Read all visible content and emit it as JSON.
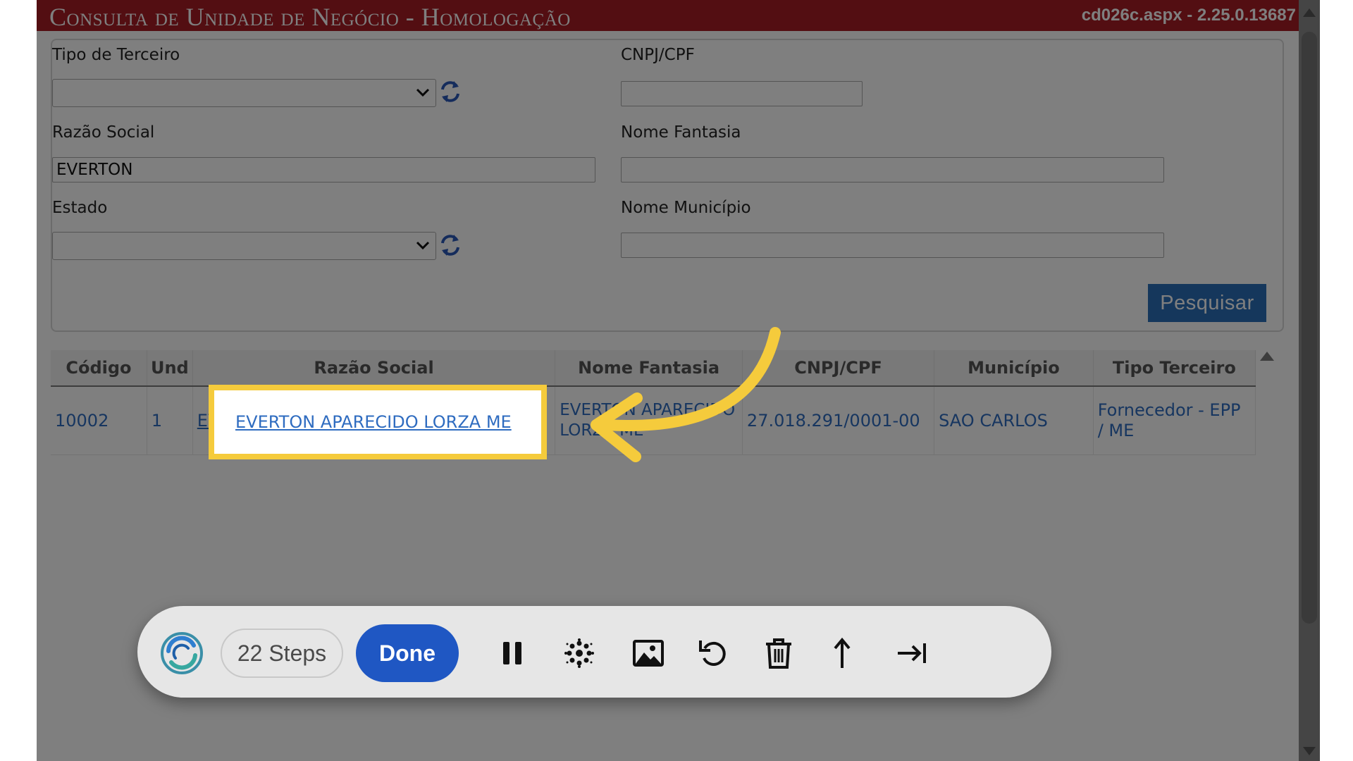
{
  "header": {
    "title": "Consulta de Unidade de Negócio  - Homologação",
    "page_info": "cd026c.aspx - 2.25.0.13687"
  },
  "form": {
    "tipo_terceiro": {
      "label": "Tipo de Terceiro",
      "value": ""
    },
    "cnpj_cpf": {
      "label": "CNPJ/CPF",
      "value": ""
    },
    "razao_social": {
      "label": "Razão Social",
      "value": "EVERTON"
    },
    "nome_fantasia": {
      "label": "Nome Fantasia",
      "value": ""
    },
    "estado": {
      "label": "Estado",
      "value": ""
    },
    "nome_municipio": {
      "label": "Nome Município",
      "value": ""
    },
    "search_button": "Pesquisar"
  },
  "results": {
    "columns": [
      "Código",
      "Und",
      "Razão Social",
      "Nome Fantasia",
      "CNPJ/CPF",
      "Município",
      "Tipo Terceiro"
    ],
    "rows": [
      {
        "codigo": "10002",
        "und": "1",
        "razao_social": "EVERTON APARECIDO LORZA ME",
        "nome_fantasia": "EVERTON APARECIDO LORZA ME",
        "cnpj_cpf": "27.018.291/0001-00",
        "municipio": "SAO CARLOS",
        "tipo_terceiro": "Fornecedor - EPP / ME"
      }
    ]
  },
  "recorder_toolbar": {
    "steps_label": "22 Steps",
    "done_label": "Done",
    "icons": [
      "logo-icon",
      "pause-icon",
      "blur-icon",
      "image-icon",
      "undo-icon",
      "trash-icon",
      "arrow-up-icon",
      "skip-to-end-icon"
    ]
  },
  "colors": {
    "header_bg": "#a61c24",
    "accent_button": "#2a6fb8",
    "link": "#2f6cc0",
    "highlight": "#f5cb3c",
    "done_button": "#1f57c3"
  }
}
